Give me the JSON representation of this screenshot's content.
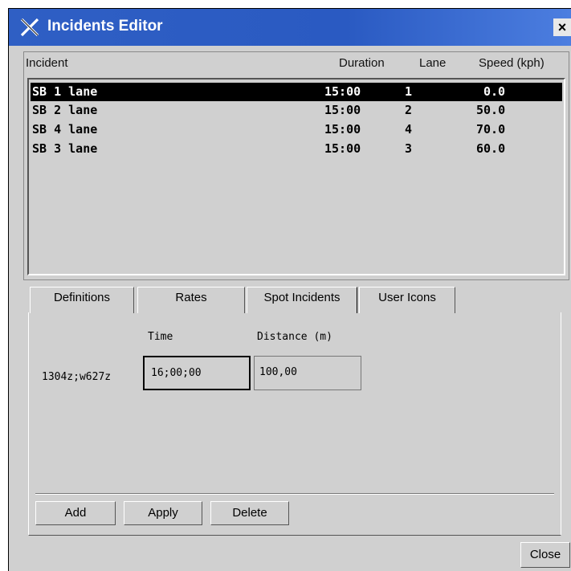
{
  "window": {
    "title": "Incidents Editor",
    "close_glyph": "×",
    "app_icon": "x-logo-icon"
  },
  "incident_list": {
    "columns": [
      "Incident",
      "Duration",
      "Lane",
      "Speed (kph)"
    ],
    "rows": [
      {
        "incident": "SB 1 lane",
        "duration": "15:00",
        "lane": "1",
        "speed": "0.0",
        "selected": true
      },
      {
        "incident": "SB 2 lane",
        "duration": "15:00",
        "lane": "2",
        "speed": "50.0",
        "selected": false
      },
      {
        "incident": "SB 4 lane",
        "duration": "15:00",
        "lane": "4",
        "speed": "70.0",
        "selected": false
      },
      {
        "incident": "SB 3 lane",
        "duration": "15:00",
        "lane": "3",
        "speed": "60.0",
        "selected": false
      }
    ]
  },
  "tabs": [
    {
      "label": "Definitions",
      "active": false
    },
    {
      "label": "Rates",
      "active": false
    },
    {
      "label": "Spot Incidents",
      "active": true
    },
    {
      "label": "User Icons",
      "active": false
    }
  ],
  "spot_incidents": {
    "time_label": "Time",
    "distance_label": "Distance (m)",
    "location": "1304z;w627z",
    "time_value": "16;00;00",
    "distance_value": "100,00"
  },
  "buttons": {
    "add": "Add",
    "apply": "Apply",
    "delete": "Delete",
    "close": "Close"
  },
  "colors": {
    "titlebar": "#2f5fc4",
    "background": "#d0d0d0",
    "selection": "#000000"
  }
}
